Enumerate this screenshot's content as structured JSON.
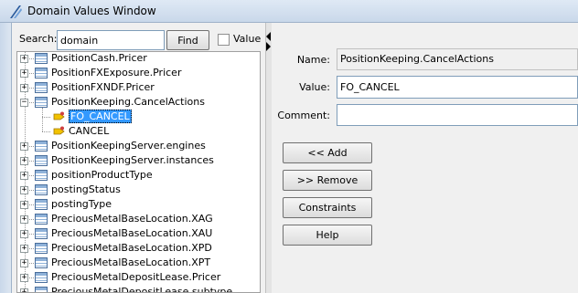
{
  "window": {
    "title": "Domain Values Window"
  },
  "search": {
    "label": "Search:",
    "value": "domain",
    "find_label": "Find",
    "value_checkbox_label": "Value",
    "value_checked": false
  },
  "tree": {
    "items": [
      {
        "label": "PositionCash.Pricer",
        "expanded": false,
        "level": 0
      },
      {
        "label": "PositionFXExposure.Pricer",
        "expanded": false,
        "level": 0
      },
      {
        "label": "PositionFXNDF.Pricer",
        "expanded": false,
        "level": 0
      },
      {
        "label": "PositionKeeping.CancelActions",
        "expanded": true,
        "level": 0
      },
      {
        "label": "FO_CANCEL",
        "level": 1,
        "selected": true
      },
      {
        "label": "CANCEL",
        "level": 1
      },
      {
        "label": "PositionKeepingServer.engines",
        "expanded": false,
        "level": 0
      },
      {
        "label": "PositionKeepingServer.instances",
        "expanded": false,
        "level": 0
      },
      {
        "label": "positionProductType",
        "expanded": false,
        "level": 0
      },
      {
        "label": "postingStatus",
        "expanded": false,
        "level": 0
      },
      {
        "label": "postingType",
        "expanded": false,
        "level": 0
      },
      {
        "label": "PreciousMetalBaseLocation.XAG",
        "expanded": false,
        "level": 0
      },
      {
        "label": "PreciousMetalBaseLocation.XAU",
        "expanded": false,
        "level": 0
      },
      {
        "label": "PreciousMetalBaseLocation.XPD",
        "expanded": false,
        "level": 0
      },
      {
        "label": "PreciousMetalBaseLocation.XPT",
        "expanded": false,
        "level": 0
      },
      {
        "label": "PreciousMetalDepositLease.Pricer",
        "expanded": false,
        "level": 0
      },
      {
        "label": "PreciousMetalDepositLease.subtype",
        "expanded": false,
        "level": 0
      }
    ]
  },
  "detail": {
    "name_label": "Name:",
    "name_value": "PositionKeeping.CancelActions",
    "value_label": "Value:",
    "value_value": "FO_CANCEL",
    "comment_label": "Comment:",
    "comment_value": "",
    "add_label": "<< Add",
    "remove_label": ">> Remove",
    "constraints_label": "Constraints",
    "help_label": "Help"
  },
  "colors": {
    "selection": "#3399ff",
    "panel": "#f0f0f0",
    "titlebar": "#c9d8ea"
  }
}
